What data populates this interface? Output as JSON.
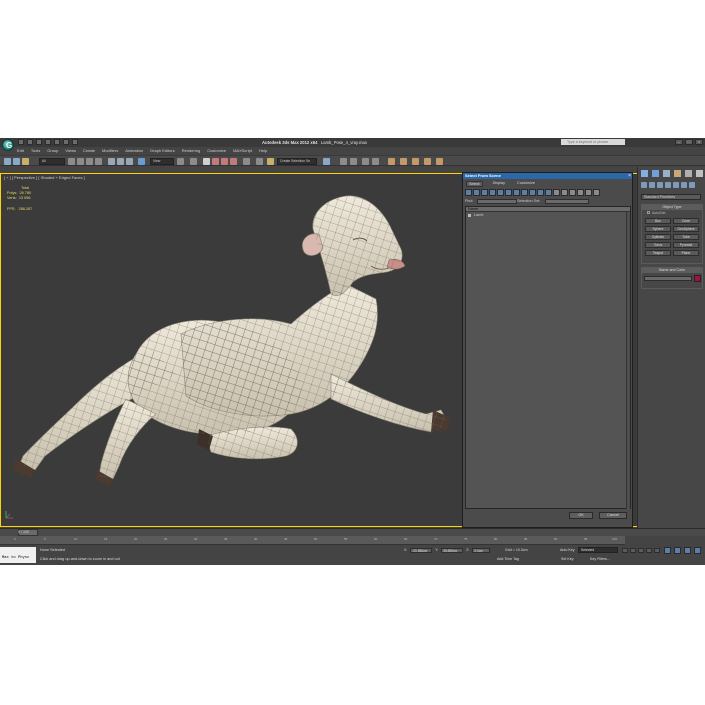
{
  "window": {
    "title_app": "Autodesk 3ds Max  2012 x64",
    "title_file": "Lamb_Pose_4_vray.max",
    "search_placeholder": "Type a keyword or phrase"
  },
  "menu": [
    "Edit",
    "Tools",
    "Group",
    "Views",
    "Create",
    "Modifiers",
    "Animation",
    "Graph Editors",
    "Rendering",
    "Customize",
    "MAXScript",
    "Help"
  ],
  "toolbar": {
    "selection_filter": "All",
    "reference_coord": "View",
    "named_selection": "Create Selection Se"
  },
  "viewport": {
    "label": "[ + ] [ Perspective ] [ Shaded + Edged Faces ]",
    "stats_header": "Total",
    "polys_label": "Polys:",
    "polys_value": "26 780",
    "verts_label": "Verts:",
    "verts_value": "13 596",
    "fps_label": "FPS:",
    "fps_value": "286.287"
  },
  "dialog": {
    "title": "Select From Scene",
    "tabs": [
      "Select",
      "Display",
      "Customize"
    ],
    "find_label": "Find:",
    "selection_set_label": "Selection Set:",
    "column_header": "Name",
    "items": [
      "Lamb"
    ],
    "ok_label": "OK",
    "cancel_label": "Cancel"
  },
  "command_panel": {
    "category": "Standard Primitives",
    "object_type_title": "Object Type",
    "autogrid_label": "AutoGrid",
    "primitives": [
      "Box",
      "Cone",
      "Sphere",
      "GeoSphere",
      "Cylinder",
      "Tube",
      "Torus",
      "Pyramid",
      "Teapot",
      "Plane"
    ],
    "name_color_title": "Name and Color",
    "color": "#a0143c"
  },
  "timeline": {
    "frame_label": "0 / 100",
    "ticks": [
      "0",
      "5",
      "10",
      "15",
      "20",
      "25",
      "30",
      "35",
      "40",
      "45",
      "50",
      "55",
      "60",
      "65",
      "70",
      "75",
      "80",
      "85",
      "90",
      "95",
      "100"
    ]
  },
  "status": {
    "maxscript": "Max to Physc",
    "line1": "None Selected",
    "line2": "Click and drag up-and-down to zoom in and out",
    "x_value": "-20.586cm",
    "y_value": "35.885cm",
    "z_value": "0.0cm",
    "grid_text": "Grid = 10.0cm",
    "add_time_tag": "Add Time Tag",
    "auto_key": "Auto Key",
    "selected": "Selected",
    "set_key": "Set Key",
    "key_filters": "Key Filters..."
  }
}
